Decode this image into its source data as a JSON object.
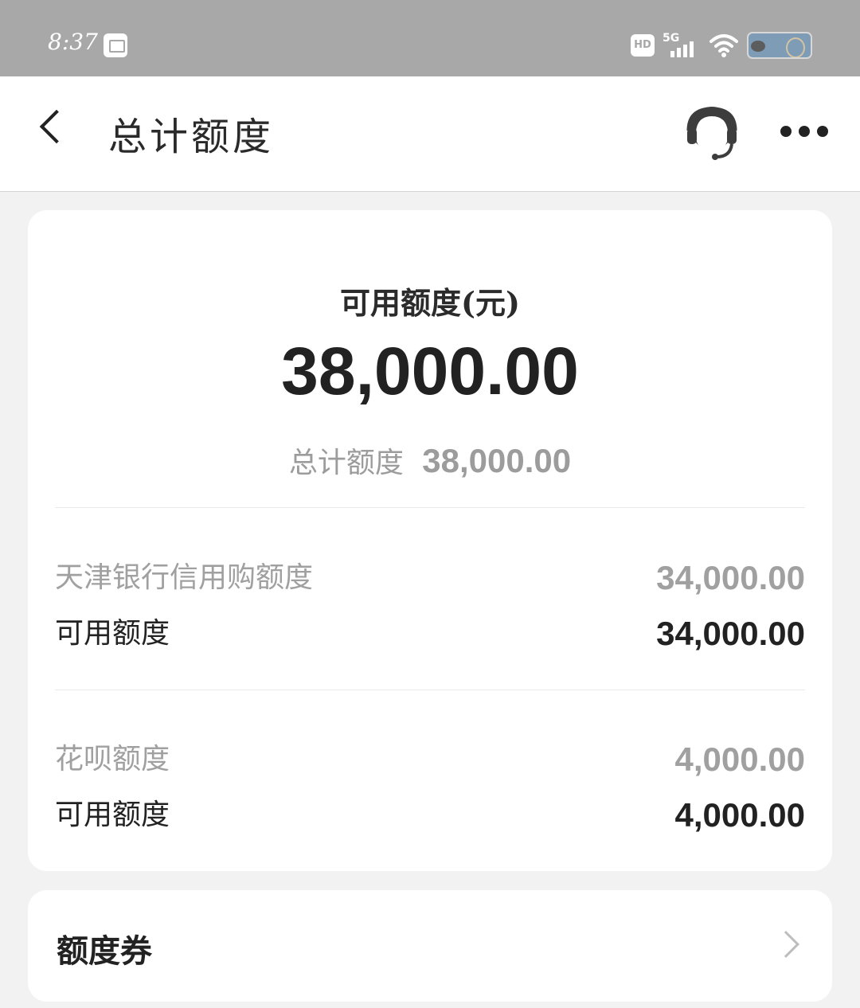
{
  "status_bar": {
    "time": "8:37",
    "hd_label": "HD",
    "network_label": "5G"
  },
  "header": {
    "title": "总计额度"
  },
  "summary": {
    "available_label": "可用额度(元)",
    "available_amount": "38,000.00",
    "total_label": "总计额度",
    "total_amount": "38,000.00"
  },
  "credit_sections": [
    {
      "title": "天津银行信用购额度",
      "title_amount": "34,000.00",
      "available_label": "可用额度",
      "available_amount": "34,000.00"
    },
    {
      "title": "花呗额度",
      "title_amount": "4,000.00",
      "available_label": "可用额度",
      "available_amount": "4,000.00"
    }
  ],
  "coupon": {
    "label": "额度券"
  },
  "colors": {
    "status_bar": "#a8a8a8",
    "page_background": "#f2f2f2",
    "card_background": "#ffffff",
    "primary_text": "#222222",
    "secondary_text": "#a0a0a0"
  },
  "icons": {
    "back": "back-arrow-icon",
    "support": "customer-service-icon",
    "more": "more-dots-icon",
    "coupon_arrow": "chevron-right-icon"
  }
}
